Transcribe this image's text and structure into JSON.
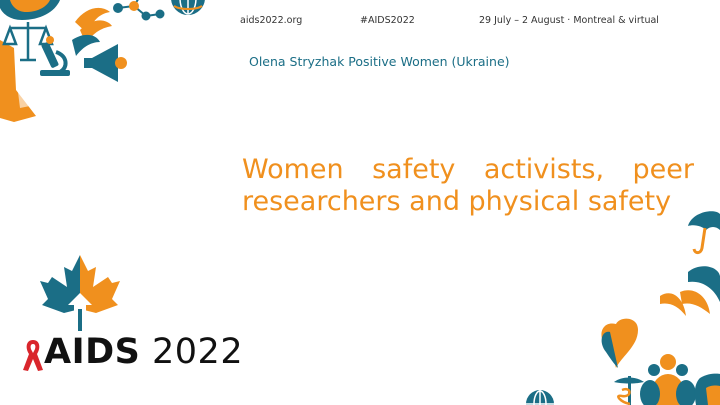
{
  "header": {
    "site": "aids2022.org",
    "hashtag": "#AIDS2022",
    "date_place": "29 July – 2 August · Montreal & virtual"
  },
  "author_line": "Olena Stryzhak Positive Women (Ukraine)",
  "title": "Women safety activists, peer researchers and physical safety",
  "logo": {
    "name_bold": "AIDS",
    "year": "2022",
    "icon": "red-ribbon-icon"
  },
  "colors": {
    "teal": "#1b6e86",
    "orange": "#f0901e",
    "red": "#d9262c",
    "text": "#333333"
  },
  "decor_icons": [
    "scales-of-justice-icon",
    "microscope-icon",
    "megaphone-icon",
    "flask-icon",
    "globe-icon",
    "molecule-icon",
    "flame-icon",
    "umbrella-icon",
    "heart-icon",
    "people-icon",
    "caduceus-icon",
    "maple-leaf-icon"
  ]
}
